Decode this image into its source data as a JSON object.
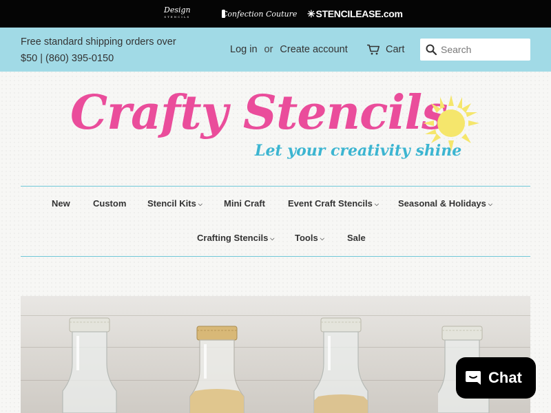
{
  "sister_sites": {
    "design": "Design",
    "design_sub": "STENCILS",
    "confection": "Confection Couture",
    "stencilease": "STENCILEASE.com"
  },
  "announcement": {
    "line1": "Free standard shipping orders over",
    "line2": "$50 | (860) 395-0150"
  },
  "account": {
    "login": "Log in",
    "or": "or",
    "create": "Create account",
    "cart": "Cart"
  },
  "search": {
    "placeholder": "Search"
  },
  "logo": {
    "name": "Crafty Stencils",
    "tagline": "Let your creativity shine"
  },
  "nav": {
    "row1": [
      {
        "label": "New",
        "dropdown": false
      },
      {
        "label": "Custom",
        "dropdown": false
      },
      {
        "label": "Stencil Kits",
        "dropdown": true
      },
      {
        "label": "Mini Craft",
        "dropdown": false
      },
      {
        "label": "Event Craft Stencils",
        "dropdown": true
      },
      {
        "label": "Seasonal & Holidays",
        "dropdown": true
      }
    ],
    "row2": [
      {
        "label": "Crafting Stencils",
        "dropdown": true
      },
      {
        "label": "Tools",
        "dropdown": true
      },
      {
        "label": "Sale",
        "dropdown": false
      }
    ]
  },
  "chat": {
    "label": "Chat"
  },
  "colors": {
    "util_bar": "#a1dae6",
    "logo_pink": "#ea4d9b",
    "logo_blue": "#3cb5d1",
    "sun_yellow": "#f5e66c",
    "nav_border": "#6ec6d6"
  }
}
